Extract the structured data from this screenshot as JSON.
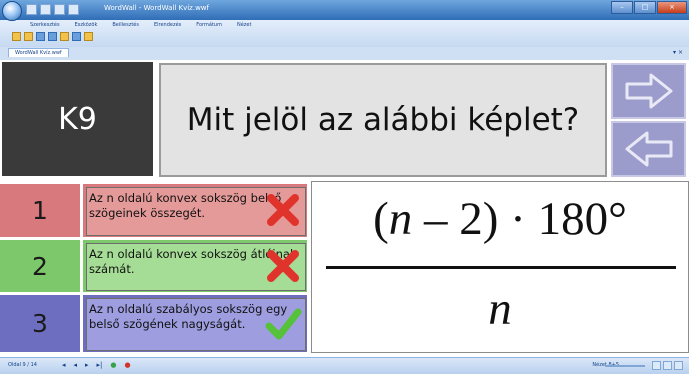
{
  "window": {
    "title": "WordWall - WordWall Kvíz.wwf",
    "controls": [
      "–",
      "□",
      "×"
    ]
  },
  "ribbon": {
    "menu": [
      "Szerkesztés",
      "Eszközök",
      "Beillesztés",
      "Elrendezés",
      "Formátum",
      "Nézet"
    ]
  },
  "document_tab": {
    "label": "WordWall Kvíz.wwf",
    "controls": "▾ ×"
  },
  "question": {
    "id": "K9",
    "text": "Mit jelöl az alábbi képlet?"
  },
  "answers": [
    {
      "number": "1",
      "text": "Az n oldalú konvex sokszög belső szögeinek összegét.",
      "mark": "cross-icon"
    },
    {
      "number": "2",
      "text": "Az n oldalú konvex sokszög átlóinak számát.",
      "mark": "cross-icon"
    },
    {
      "number": "3",
      "text": "Az n oldalú szabályos sokszög egy belső szögének nagyságát.",
      "mark": "check-icon"
    }
  ],
  "formula": {
    "numerator_prefix": "(",
    "numerator_var": "n",
    "numerator_suffix": " – 2) · 180°",
    "denominator": "n"
  },
  "statusbar": {
    "slide_counter": "Oldal 9 / 14",
    "nav_glyphs": [
      "◂",
      "◂",
      "▸",
      "▸|"
    ],
    "zoom": "Nézet 8+5"
  },
  "colors": {
    "question_id_bg": "#3a3a3a",
    "question_bg": "#e3e3e3",
    "nav_button_bg": "#9b9bcc",
    "answer1_bg": "#d7797d",
    "answer2_bg": "#7cc86a",
    "answer3_bg": "#6e6ec0",
    "cross": "#e0332c",
    "check": "#55c23a"
  }
}
